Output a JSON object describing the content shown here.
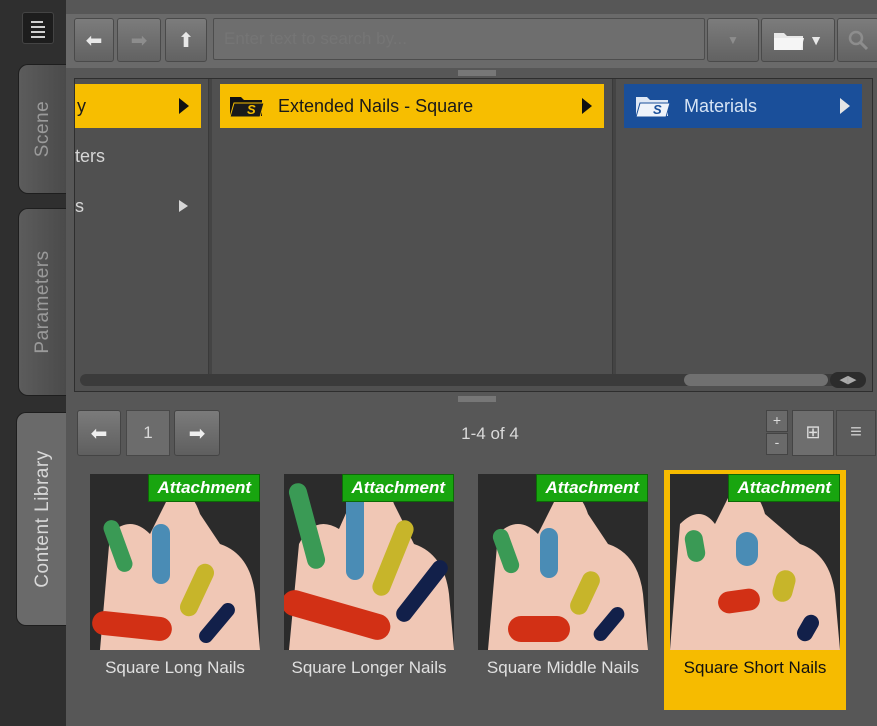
{
  "sidebar": {
    "tabs": [
      {
        "label": "Scene"
      },
      {
        "label": "Parameters"
      },
      {
        "label": "Content Library"
      }
    ]
  },
  "toolbar": {
    "back": "◀",
    "forward": "▶",
    "up": "▲",
    "search_placeholder": "Enter text to search by..."
  },
  "columns": {
    "col1": {
      "selected": "y",
      "items": [
        "ters",
        "s"
      ]
    },
    "col2": {
      "selected": "Extended Nails - Square"
    },
    "col3": {
      "selected": "Materials"
    }
  },
  "pager": {
    "page": "1",
    "count": "1-4 of 4"
  },
  "items": [
    {
      "badge": "Attachment",
      "name": "Square Long Nails"
    },
    {
      "badge": "Attachment",
      "name": "Square Longer Nails"
    },
    {
      "badge": "Attachment",
      "name": "Square Middle Nails"
    },
    {
      "badge": "Attachment",
      "name": "Square Short Nails"
    }
  ],
  "colors": {
    "selection_yellow": "#f7be00",
    "selection_blue": "#1a4f9a",
    "badge_green": "#18a50f"
  }
}
